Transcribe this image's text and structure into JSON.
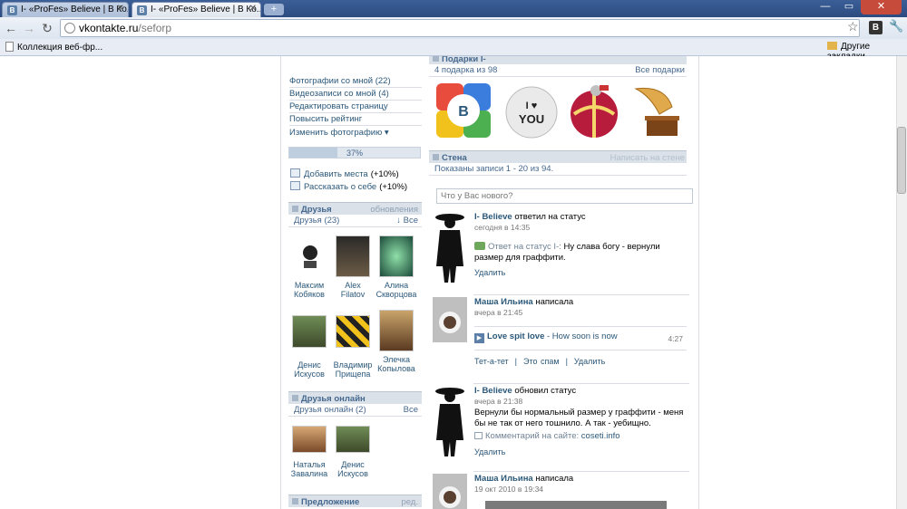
{
  "browser": {
    "tabs": [
      {
        "favicon": "B",
        "title": "I- «ProFes» Believe | В Ко..."
      },
      {
        "favicon": "B",
        "title": "I- «ProFes» Believe | В Ко..."
      }
    ],
    "new_tab_label": "+",
    "window_buttons": {
      "minimize": "—",
      "maximize": "▭",
      "close": "✕"
    },
    "url_host": "vkontakte.ru",
    "url_path": "/seforp",
    "extension_label": "B",
    "bookmarks": {
      "left": "Коллекция веб-фр...",
      "right": "Другие закладки"
    }
  },
  "left": {
    "menu": [
      "Фотографии со мной (22)",
      "Видеозаписи со мной (4)",
      "Редактировать страницу",
      "Повысить рейтинг",
      "Изменить фотографию ▾"
    ],
    "rating": {
      "text": "37%",
      "fraction": 0.37
    },
    "actions": [
      {
        "label": "Добавить места",
        "bonus": "(+10%)"
      },
      {
        "label": "Рассказать о себе",
        "bonus": "(+10%)"
      }
    ],
    "friends": {
      "header": "Друзья",
      "header_right": "обновления",
      "sub": "Друзья (23)",
      "sub_right": "↓ Все",
      "items": [
        {
          "first": "Максим",
          "last": "Кобяков"
        },
        {
          "first": "Alex",
          "last": "Filatov"
        },
        {
          "first": "Алина",
          "last": "Скворцова"
        },
        {
          "first": "Денис",
          "last": "Искусов"
        },
        {
          "first": "Владимир",
          "last": "Прищепа"
        },
        {
          "first": "Элечка",
          "last": "Копылова"
        }
      ]
    },
    "online": {
      "header": "Друзья онлайн",
      "sub": "Друзья онлайн (2)",
      "sub_right": "Все",
      "items": [
        {
          "first": "Наталья",
          "last": "Завалина"
        },
        {
          "first": "Денис",
          "last": "Искусов"
        }
      ]
    },
    "offer": {
      "header": "Предложение",
      "header_right": "ред."
    }
  },
  "right": {
    "gifts": {
      "header": "Подарки I-",
      "sub": "4 подарка из 98",
      "sub_right": "Все подарки",
      "items": [
        {
          "name": "vk-logo-gift"
        },
        {
          "name": "i-love-you-gift",
          "text": "I ♥ YOU"
        },
        {
          "name": "ribbon-ball-gift"
        },
        {
          "name": "gramophone-gift"
        }
      ]
    },
    "wall": {
      "header": "Стена",
      "header_right": "Написать на стене",
      "sub": "Показаны записи 1 - 20 из 94.",
      "placeholder": "Что у Вас нового?"
    },
    "posts": [
      {
        "author": "I- Believe",
        "verb": "ответил на статус",
        "date": "сегодня в 14:35",
        "body_prefix": "Ответ на статус I-:",
        "body": "Ну слава богу - вернули размер для граффити.",
        "actions": "Удалить"
      },
      {
        "author": "Маша Ильина",
        "verb": "написала",
        "date": "вчера в 21:45",
        "audio_title": "Love spit love",
        "audio_track": "- How soon is now",
        "audio_time": "4:27",
        "actions": "Тет-а-тет  |  Это спам  |  Удалить"
      },
      {
        "author": "I- Believe",
        "verb": "обновил статус",
        "date": "вчера в 21:38",
        "body": "Вернули бы нормальный размер у граффити - меня бы не так от него тошнило. А так - уебищно.",
        "comment_prefix": "Комментарий на сайте:",
        "comment_site": "coseti.info",
        "actions": "Удалить"
      },
      {
        "author": "Маша Ильина",
        "verb": "написала",
        "date": "19 окт 2010 в 19:34"
      }
    ]
  }
}
